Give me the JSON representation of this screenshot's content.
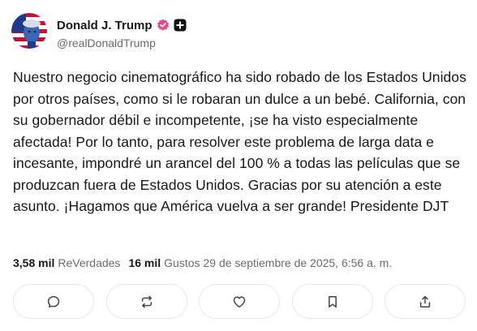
{
  "author": {
    "name": "Donald J. Trump",
    "handle": "@realDonaldTrump",
    "verified_badge_color": "#e64a8b",
    "icons": [
      "avatar",
      "verified-badge-icon",
      "organization-badge-icon"
    ]
  },
  "post": {
    "text": "Nuestro negocio cinematográfico ha sido robado de los Estados Unidos por otros países, como si le robaran un dulce a un bebé. California, con su gobernador débil e incompetente, ¡se ha visto especialmente afectada! Por lo tanto, para resolver este problema de larga data e incesante, impondré un arancel del 100 % a todas las películas que se produzcan fuera de Estados Unidos. Gracias por su atención a este asunto. ¡Hagamos que América vuelva a ser grande! Presidente DJT"
  },
  "stats": {
    "reposts_count": "3,58 mil",
    "reposts_label": "ReVerdades",
    "likes_count": "16 mil",
    "likes_label": "Gustos",
    "timestamp": "29 de septiembre de 2025, 6:56 a. m."
  },
  "actions": [
    {
      "name": "reply",
      "icon": "comment-icon"
    },
    {
      "name": "repost",
      "icon": "repost-icon"
    },
    {
      "name": "like",
      "icon": "heart-icon"
    },
    {
      "name": "bookmark",
      "icon": "bookmark-icon"
    },
    {
      "name": "share",
      "icon": "share-icon"
    }
  ]
}
